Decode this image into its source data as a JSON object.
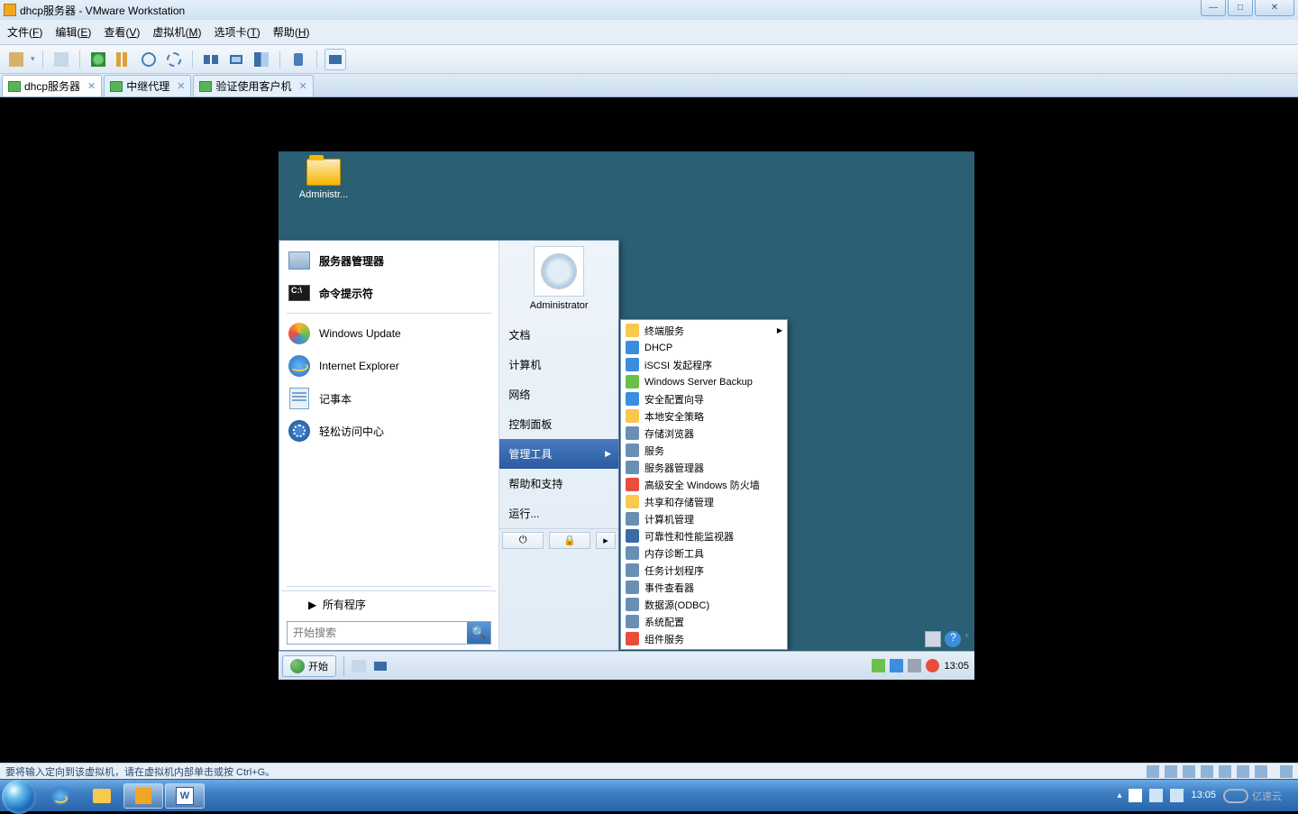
{
  "outer_window": {
    "title": "dhcp服务器 - VMware Workstation"
  },
  "vmw_menu": [
    {
      "l": "文件",
      "k": "F"
    },
    {
      "l": "编辑",
      "k": "E"
    },
    {
      "l": "查看",
      "k": "V"
    },
    {
      "l": "虚拟机",
      "k": "M"
    },
    {
      "l": "选项卡",
      "k": "T"
    },
    {
      "l": "帮助",
      "k": "H"
    }
  ],
  "vmw_tabs": [
    {
      "label": "dhcp服务器",
      "active": true
    },
    {
      "label": "中继代理",
      "active": false
    },
    {
      "label": "验证使用客户机",
      "active": false
    }
  ],
  "guest_desktop": {
    "icon_label": "Administr..."
  },
  "start_menu": {
    "left_pinned": [
      {
        "label": "服务器管理器",
        "icon": "server-icon",
        "bold": true
      },
      {
        "label": "命令提示符",
        "icon": "cmd-icon",
        "bold": true
      }
    ],
    "left_items": [
      {
        "label": "Windows Update",
        "icon": "update-icon"
      },
      {
        "label": "Internet Explorer",
        "icon": "ie-icon"
      },
      {
        "label": "记事本",
        "icon": "notepad-icon"
      },
      {
        "label": "轻松访问中心",
        "icon": "accessibility-icon"
      }
    ],
    "all_programs": "所有程序",
    "search_placeholder": "开始搜索",
    "user": "Administrator",
    "right_items": [
      {
        "label": "文档"
      },
      {
        "label": "计算机"
      },
      {
        "label": "网络"
      },
      {
        "label": "控制面板"
      },
      {
        "label": "管理工具",
        "hl": true,
        "sub": true
      },
      {
        "label": "帮助和支持"
      },
      {
        "label": "运行..."
      }
    ]
  },
  "admin_tools": [
    {
      "label": "终端服务",
      "sub": true,
      "c": "#f8c94e"
    },
    {
      "label": "DHCP",
      "c": "#3b8ede"
    },
    {
      "label": "iSCSI 发起程序",
      "c": "#3b8ede"
    },
    {
      "label": "Windows Server Backup",
      "c": "#6cc04a"
    },
    {
      "label": "安全配置向导",
      "c": "#3b8ede"
    },
    {
      "label": "本地安全策略",
      "c": "#f8c94e"
    },
    {
      "label": "存储浏览器",
      "c": "#6a8fb5"
    },
    {
      "label": "服务",
      "c": "#6a8fb5"
    },
    {
      "label": "服务器管理器",
      "c": "#6a8fb5"
    },
    {
      "label": "高级安全 Windows 防火墙",
      "c": "#e94e3b"
    },
    {
      "label": "共享和存储管理",
      "c": "#f8c94e"
    },
    {
      "label": "计算机管理",
      "c": "#6a8fb5"
    },
    {
      "label": "可靠性和性能监视器",
      "c": "#3a6ca5"
    },
    {
      "label": "内存诊断工具",
      "c": "#6a8fb5"
    },
    {
      "label": "任务计划程序",
      "c": "#6a8fb5"
    },
    {
      "label": "事件查看器",
      "c": "#6a8fb5"
    },
    {
      "label": "数据源(ODBC)",
      "c": "#6a8fb5"
    },
    {
      "label": "系统配置",
      "c": "#6a8fb5"
    },
    {
      "label": "组件服务",
      "c": "#e94e3b"
    }
  ],
  "guest_taskbar": {
    "start": "开始",
    "clock": "13:05"
  },
  "vmw_status": "要将输入定向到该虚拟机，请在虚拟机内部单击或按 Ctrl+G。",
  "host": {
    "time": "13:05",
    "brand": "亿速云"
  }
}
